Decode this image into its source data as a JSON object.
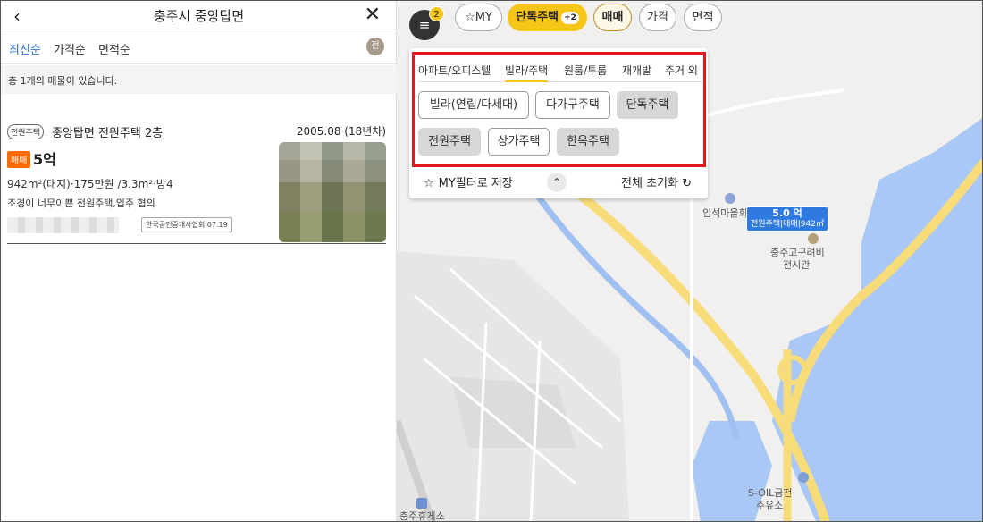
{
  "header": {
    "back_icon": "chevron-left-icon",
    "title": "충주시 중앙탑면",
    "close_icon": "close-icon"
  },
  "sort": {
    "options": [
      "최신순",
      "가격순",
      "면적순"
    ],
    "active": "최신순",
    "icon_glyph": "전"
  },
  "count_text": "총 1개의 매물이 있습니다.",
  "listing": {
    "tag": "전원주택",
    "name": "중앙탑면 전원주택 2층",
    "date": "2005.08 (18년차)",
    "deal": "매매",
    "price": "5억",
    "specs": "942m²(대지)·175만원 /3.3m²·방4",
    "desc": "조경이 너무이쁜 전원주택,입주 협의",
    "source": "한국공인중개사협회 07.19"
  },
  "filterbar": {
    "badge": "2",
    "my": "MY",
    "type_label": "단독주택",
    "type_plus": "+2",
    "deal": "매매",
    "price": "가격",
    "area": "면적"
  },
  "panel": {
    "tabs": [
      "아파트/오피스텔",
      "빌라/주택",
      "원룸/투룸",
      "재개발",
      "주거 외"
    ],
    "active_tab": "빌라/주택",
    "chips": [
      {
        "label": "빌라(연립/다세대)",
        "selected": false
      },
      {
        "label": "다가구주택",
        "selected": false
      },
      {
        "label": "단독주택",
        "selected": true
      },
      {
        "label": "전원주택",
        "selected": true
      },
      {
        "label": "상가주택",
        "selected": false
      },
      {
        "label": "한옥주택",
        "selected": true
      }
    ],
    "save_label": "MY필터로 저장",
    "reset_label": "전체 초기화"
  },
  "map": {
    "pin_price": "5.0 억",
    "pin_detail": "전원주택|매매|942㎡",
    "pois": [
      "입석마을회",
      "충주고구려비",
      "전시관",
      "S-OIL금천",
      "주유소",
      "충주휴게소"
    ]
  },
  "colors": {
    "accent": "#f5c518",
    "highlight": "#e0191e",
    "water": "#a9c8f5",
    "road": "#f8dc7a",
    "pin": "#2f7ae0",
    "active_sort": "#2b6cd8"
  }
}
